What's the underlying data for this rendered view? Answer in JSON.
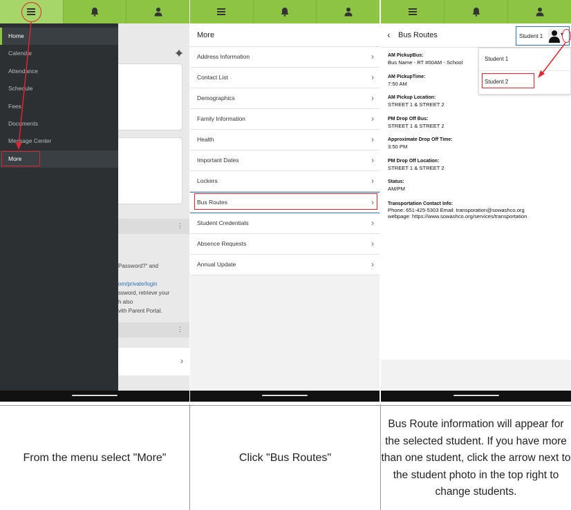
{
  "drawer": {
    "items": [
      "Home",
      "Calendar",
      "Attendance",
      "Schedule",
      "Fees",
      "Documents",
      "Message Center",
      "More"
    ]
  },
  "bg": {
    "line1": "Password?\" and",
    "line2": "om/private/login",
    "line3": "ssword, retrieve your",
    "line4": "h also",
    "line5": "vith Parent Portal."
  },
  "more": {
    "title": "More",
    "items": [
      "Address Information",
      "Contact List",
      "Demographics",
      "Family Information",
      "Health",
      "Important Dates",
      "Lockers",
      "Bus Routes",
      "Student Credentials",
      "Absence Requests",
      "Annual Update"
    ]
  },
  "bus": {
    "title": "Bus Routes",
    "student_selected": "Student 1",
    "dropdown": [
      "Student 1",
      "Student 2"
    ],
    "fields": [
      {
        "label": "AM PickupBus:",
        "value": "Bus Name - RT #00AM - School"
      },
      {
        "label": "AM PickupTime:",
        "value": "7:50 AM"
      },
      {
        "label": "AM Pickup Location:",
        "value": "STREET 1 & STREET 2"
      },
      {
        "label": "PM Drop Off Bus:",
        "value": "STREET 1 & STREET 2"
      },
      {
        "label": "Approximate Drop Off Time:",
        "value": "3:50 PM"
      },
      {
        "label": "PM Drop Off Location:",
        "value": "STREET 1 & STREET 2"
      },
      {
        "label": "Status:",
        "value": "AM/PM"
      }
    ],
    "contact_label": "Transportation Contact Info:",
    "contact_line1": "Phone: 651-425-5303 Email: transporation@sowashco.org",
    "contact_line2": "webpage: https://www.sowashco.org/services/transportation"
  },
  "captions": {
    "c1": "From the menu select \"More\"",
    "c2": "Click \"Bus Routes\"",
    "c3": "Bus Route information will appear for the selected student. If you have more than one student, click the arrow next to the student photo in the top right to change students."
  },
  "colors": {
    "accent": "#8dc443",
    "annotation": "#e0252f",
    "highlight": "#2f6fb3"
  }
}
